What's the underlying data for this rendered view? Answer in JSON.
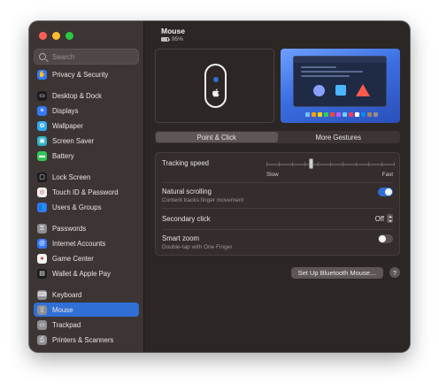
{
  "window": {
    "title": "Mouse"
  },
  "search": {
    "placeholder": "Search"
  },
  "sidebar": {
    "items": [
      {
        "label": "Privacy & Security",
        "icon": "hand-icon",
        "color": "#3478f6",
        "glyph": "✋"
      },
      {
        "label": "Desktop & Dock",
        "icon": "dock-icon",
        "color": "#1c1c1e",
        "glyph": "▭"
      },
      {
        "label": "Displays",
        "icon": "sun-icon",
        "color": "#3478f6",
        "glyph": "☀"
      },
      {
        "label": "Wallpaper",
        "icon": "flower-icon",
        "color": "#35aaf2",
        "glyph": "✿"
      },
      {
        "label": "Screen Saver",
        "icon": "screen-saver-icon",
        "color": "#30b0c7",
        "glyph": "▣"
      },
      {
        "label": "Battery",
        "icon": "battery-icon",
        "color": "#34c759",
        "glyph": "▬"
      },
      {
        "label": "Lock Screen",
        "icon": "lock-screen-icon",
        "color": "#1c1c1e",
        "glyph": "▢"
      },
      {
        "label": "Touch ID & Password",
        "icon": "fingerprint-icon",
        "color": "#f3f3f3",
        "glyph": "◎"
      },
      {
        "label": "Users & Groups",
        "icon": "users-icon",
        "color": "#3478f6",
        "glyph": "👥"
      },
      {
        "label": "Passwords",
        "icon": "key-icon",
        "color": "#8e8e93",
        "glyph": "⚿"
      },
      {
        "label": "Internet Accounts",
        "icon": "at-icon",
        "color": "#3478f6",
        "glyph": "@"
      },
      {
        "label": "Game Center",
        "icon": "game-center-icon",
        "color": "#f3f3f3",
        "glyph": "●"
      },
      {
        "label": "Wallet & Apple Pay",
        "icon": "wallet-icon",
        "color": "#1c1c1e",
        "glyph": "▤"
      },
      {
        "label": "Keyboard",
        "icon": "keyboard-icon",
        "color": "#8e8e93",
        "glyph": "⌨"
      },
      {
        "label": "Mouse",
        "icon": "mouse-icon",
        "color": "#8e8e93",
        "glyph": "▯"
      },
      {
        "label": "Trackpad",
        "icon": "trackpad-icon",
        "color": "#8e8e93",
        "glyph": "▭"
      },
      {
        "label": "Printers & Scanners",
        "icon": "printer-icon",
        "color": "#8e8e93",
        "glyph": "⎙"
      }
    ],
    "selected": "Mouse"
  },
  "header": {
    "title": "Mouse",
    "battery": "95%"
  },
  "tabs": [
    {
      "label": "Point & Click",
      "active": true
    },
    {
      "label": "More Gestures",
      "active": false
    }
  ],
  "settings": {
    "tracking_speed": {
      "label": "Tracking speed",
      "slow": "Slow",
      "fast": "Fast",
      "value": 0.35
    },
    "natural_scrolling": {
      "label": "Natural scrolling",
      "sublabel": "Content tracks finger movement",
      "enabled": true
    },
    "secondary_click": {
      "label": "Secondary click",
      "value": "Off"
    },
    "smart_zoom": {
      "label": "Smart zoom",
      "sublabel": "Double-tap with One Finger",
      "enabled": false
    }
  },
  "footer": {
    "bluetooth_button": "Set Up Bluetooth Mouse…",
    "help": "?"
  },
  "colors": {
    "accent": "#2f6fd6"
  }
}
